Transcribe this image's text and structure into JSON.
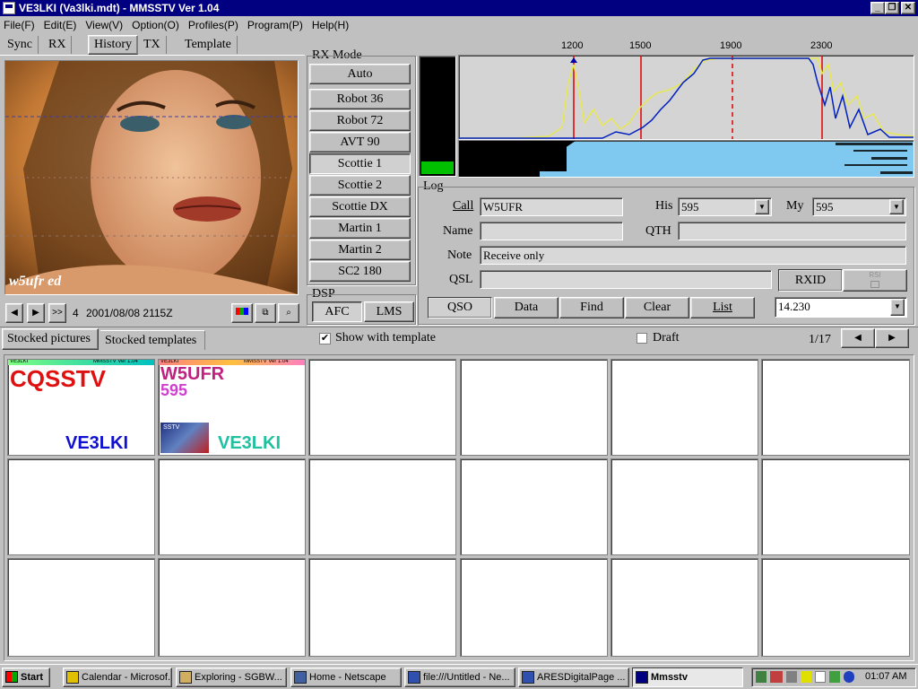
{
  "window": {
    "title": "VE3LKI (Va3lki.mdt) - MMSSTV Ver 1.04"
  },
  "menu": [
    "File(F)",
    "Edit(E)",
    "View(V)",
    "Option(O)",
    "Profiles(P)",
    "Program(P)",
    "Help(H)"
  ],
  "tabs": [
    "Sync",
    "RX",
    "History",
    "TX",
    "Template"
  ],
  "rx_mode": {
    "label": "RX Mode",
    "modes": [
      "Auto",
      "Robot 36",
      "Robot 72",
      "AVT 90",
      "Scottie 1",
      "Scottie 2",
      "Scottie DX",
      "Martin 1",
      "Martin 2",
      "SC2 180"
    ],
    "selected": "Scottie 1"
  },
  "dsp": {
    "label": "DSP",
    "afc": "AFC",
    "lms": "LMS"
  },
  "spectrum": {
    "freqs": [
      "1200",
      "1500",
      "1900",
      "2300"
    ]
  },
  "history": {
    "index": "4",
    "datetime": "2001/08/08 2115Z",
    "nav_first": ">>",
    "signature": "w5ufr ed"
  },
  "log": {
    "label": "Log",
    "call_label": "Call",
    "call": "W5UFR",
    "his_label": "His",
    "his": "595",
    "my_label": "My",
    "my": "595",
    "name_label": "Name",
    "name": "",
    "qth_label": "QTH",
    "qth": "",
    "note_label": "Note",
    "note": "Receive only",
    "qsl_label": "QSL",
    "qsl": "",
    "rxid": "RXID",
    "rxid_small": "RSI",
    "buttons": [
      "QSO",
      "Data",
      "Find",
      "Clear",
      "List"
    ],
    "freq": "14.230"
  },
  "lower_tabs": [
    "Stocked pictures",
    "Stocked templates"
  ],
  "show_template": "Show with template",
  "draft": "Draft",
  "page": "1/17",
  "thumbs": {
    "t1": {
      "header": "VE3LKI",
      "ver": "MMSSTV Ver 1.04",
      "big": "CQSSTV",
      "call": "VE3LKI"
    },
    "t2": {
      "header": "VE3LKI",
      "ver": "MMSSTV Ver 1.04",
      "call1": "W5UFR",
      "rs": "595",
      "call": "VE3LKI",
      "mini": "SSTV"
    }
  },
  "taskbar": {
    "start": "Start",
    "tasks": [
      "Calendar - Microsof...",
      "Exploring - SGBW...",
      "Home - Netscape",
      "file:///Untitled - Ne...",
      "ARESDigitalPage ...",
      "Mmsstv"
    ],
    "clock": "01:07 AM"
  },
  "colors": {
    "title": "#000080",
    "spectrum_bg": "#d4d4d4",
    "waterfall": "#7fc8f0",
    "level": "#00c000"
  }
}
